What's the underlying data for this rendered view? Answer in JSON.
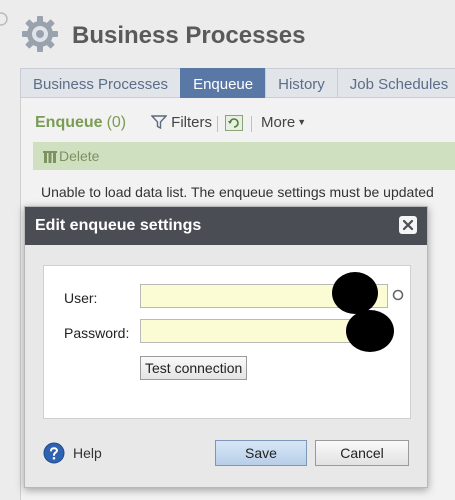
{
  "page": {
    "title": "Business Processes",
    "icon": "gear-icon"
  },
  "tabs": [
    {
      "label": "Business Processes",
      "active": false
    },
    {
      "label": "Enqueue",
      "active": true
    },
    {
      "label": "History",
      "active": false
    },
    {
      "label": "Job Schedules",
      "active": false
    }
  ],
  "list": {
    "title": "Enqueue",
    "count": "(0)",
    "toolbar": {
      "filters_label": "Filters",
      "filters_icon": "filter-icon",
      "refresh_icon": "refresh-icon",
      "more_label": "More"
    },
    "delete_label": "Delete",
    "delete_icon": "delete-icon",
    "error_message": "Unable to load data list. The enqueue settings must be updated"
  },
  "dialog": {
    "title": "Edit enqueue settings",
    "close_icon": "close-icon",
    "user_label": "User:",
    "user_value": "",
    "password_label": "Password:",
    "password_value": "",
    "test_connection_label": "Test connection",
    "help_label": "Help",
    "help_icon": "help-icon",
    "save_label": "Save",
    "cancel_label": "Cancel"
  },
  "colors": {
    "active_tab": "#5a78a6",
    "list_title": "#7a9c55",
    "action_bar": "#cfe0c0",
    "dialog_header": "#4a4e54",
    "input_bg": "#fbfbd4"
  }
}
